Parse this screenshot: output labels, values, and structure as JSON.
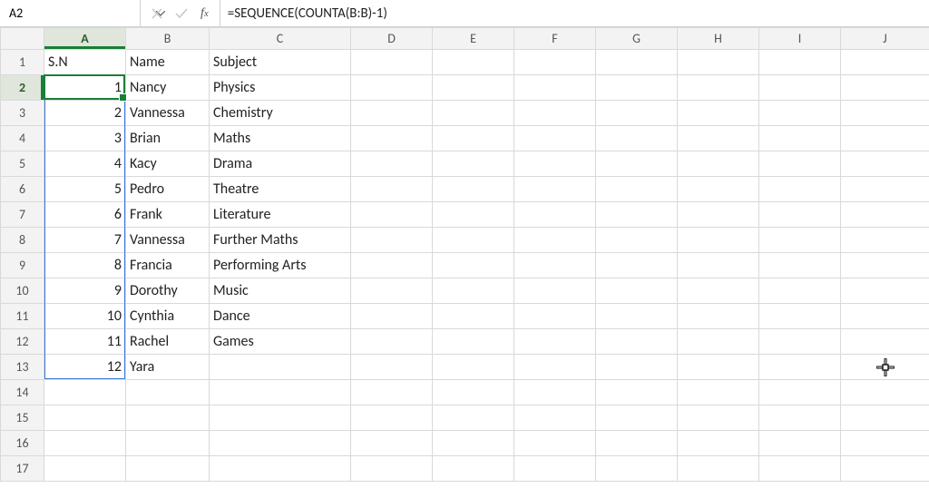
{
  "formula_bar": {
    "cell_ref": "A2",
    "formula": "=SEQUENCE(COUNTA(B:B)-1)"
  },
  "columns": [
    "A",
    "B",
    "C",
    "D",
    "E",
    "F",
    "G",
    "H",
    "I",
    "J"
  ],
  "active_column": "A",
  "active_row": 2,
  "visible_row_count": 17,
  "spill_end_row": 13,
  "chart_data": {
    "type": "table",
    "headers": {
      "A": "S.N",
      "B": "Name",
      "C": "Subject"
    },
    "rows": [
      {
        "sn": 1,
        "name": "Nancy",
        "subject": "Physics"
      },
      {
        "sn": 2,
        "name": "Vannessa",
        "subject": "Chemistry"
      },
      {
        "sn": 3,
        "name": "Brian",
        "subject": "Maths"
      },
      {
        "sn": 4,
        "name": "Kacy",
        "subject": "Drama"
      },
      {
        "sn": 5,
        "name": "Pedro",
        "subject": "Theatre"
      },
      {
        "sn": 6,
        "name": "Frank",
        "subject": "Literature"
      },
      {
        "sn": 7,
        "name": "Vannessa",
        "subject": "Further Maths"
      },
      {
        "sn": 8,
        "name": "Francia",
        "subject": "Performing Arts"
      },
      {
        "sn": 9,
        "name": "Dorothy",
        "subject": "Music"
      },
      {
        "sn": 10,
        "name": "Cynthia",
        "subject": "Dance"
      },
      {
        "sn": 11,
        "name": "Rachel",
        "subject": "Games"
      },
      {
        "sn": 12,
        "name": "Yara",
        "subject": ""
      }
    ]
  }
}
